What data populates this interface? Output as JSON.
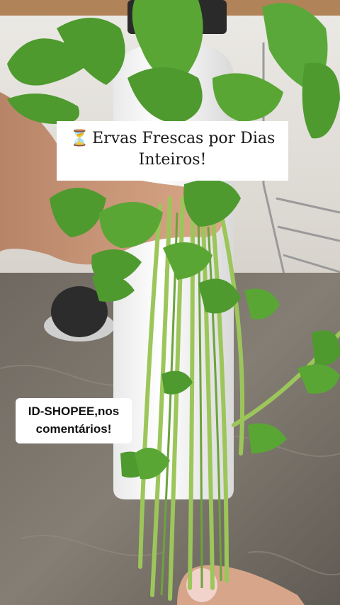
{
  "caption": {
    "icon": "hourglass-icon",
    "icon_glyph": "⏳",
    "text": "Ervas Frescas por Dias Inteiros!"
  },
  "overlay": {
    "id_tag": "ID-SHOPEE,nos comentários!"
  },
  "colors": {
    "leaf": "#4f9a2f",
    "stem": "#9cc65a",
    "countertop": "#7a746c",
    "wall": "#e8e4df"
  }
}
